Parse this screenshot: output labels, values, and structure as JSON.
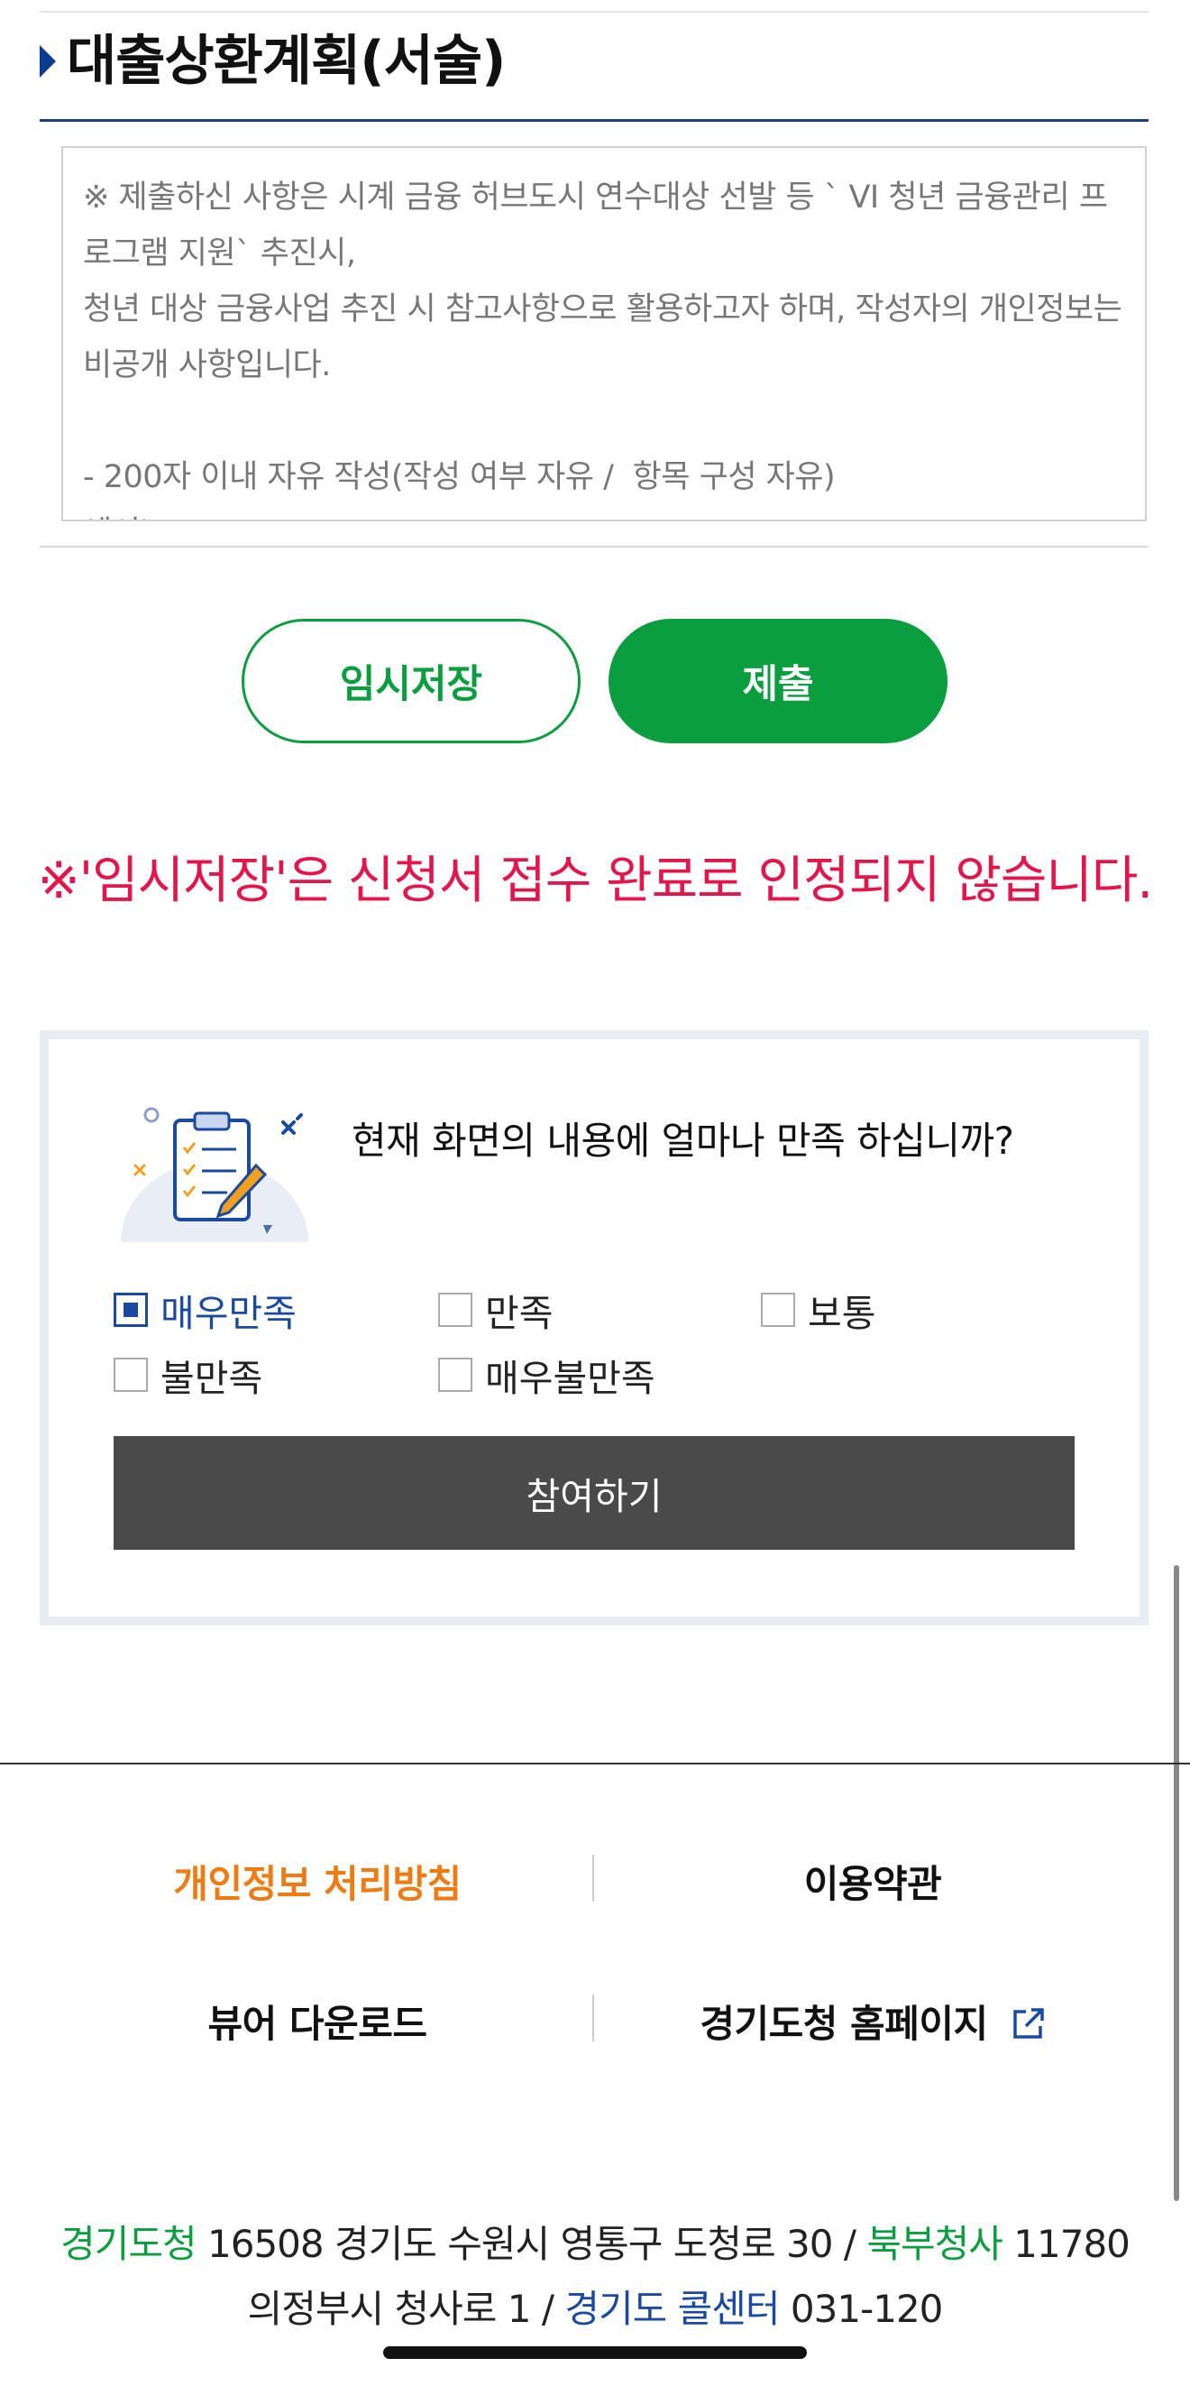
{
  "section": {
    "title": "대출상환계획(서술)"
  },
  "notice": {
    "text": "※ 제출하신 사항은 시계 금융 허브도시 연수대상 선발 등 ` VI 청년 금융관리 프로그램 지원` 추진시,\n청년 대상 금융사업 추진 시 참고사항으로 활용하고자 하며, 작성자의 개인정보는 비공개 사항입니다.\n\n- 200자 이내 자유 작성(작성 여부 자유 /  항목 구성 자유)\n예시)"
  },
  "buttons": {
    "temp_save": "임시저장",
    "submit": "제출"
  },
  "warning": "※'임시저장'은 신청서 접수 완료로 인정되지 않습니다.",
  "survey": {
    "question": "현재 화면의 내용에 얼마나 만족 하십니까?",
    "options": [
      {
        "label": "매우만족",
        "checked": true
      },
      {
        "label": "만족",
        "checked": false
      },
      {
        "label": "보통",
        "checked": false
      },
      {
        "label": "불만족",
        "checked": false
      },
      {
        "label": "매우불만족",
        "checked": false
      }
    ],
    "participate_label": "참여하기",
    "icon": "clipboard-checklist-icon"
  },
  "footer": {
    "privacy": "개인정보 처리방침",
    "terms": "이용약관",
    "viewer": "뷰어 다운로드",
    "homepage": "경기도청 홈페이지",
    "homepage_icon": "external-link-icon"
  },
  "address": {
    "gg_name": "경기도청",
    "gg_addr": "16508 경기도 수원시 영통구 도청로 30 /",
    "north_name": "북부청사",
    "north_addr": "11780",
    "north_addr2": "의정부시 청사로 1 /",
    "call_name": "경기도 콜센터",
    "call_number": "031-120"
  },
  "colors": {
    "green": "#0a9e3e",
    "navy": "#1c3f86",
    "warning": "#e3154b",
    "privacy_orange": "#f07b12"
  }
}
